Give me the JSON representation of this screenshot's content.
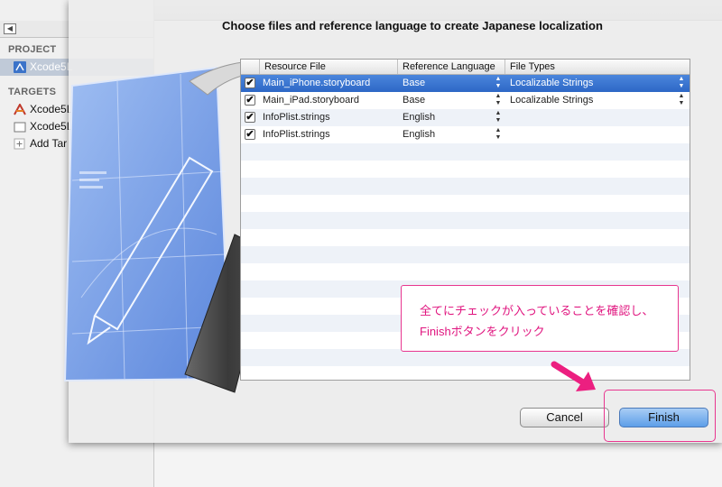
{
  "sheet": {
    "title": "Choose files and reference language to create Japanese localization"
  },
  "navigator": {
    "project_header": "PROJECT",
    "project_item": "Xcode5L",
    "targets_header": "TARGETS",
    "targets": [
      "Xcode5L",
      "Xcode5L",
      "Add Tar"
    ]
  },
  "table": {
    "columns": [
      "Resource File",
      "Reference Language",
      "File Types"
    ],
    "rows": [
      {
        "checked": true,
        "file": "Main_iPhone.storyboard",
        "language": "Base",
        "type": "Localizable Strings",
        "selected": true
      },
      {
        "checked": true,
        "file": "Main_iPad.storyboard",
        "language": "Base",
        "type": "Localizable Strings",
        "selected": false
      },
      {
        "checked": true,
        "file": "InfoPlist.strings",
        "language": "English",
        "type": "",
        "selected": false
      },
      {
        "checked": true,
        "file": "InfoPlist.strings",
        "language": "English",
        "type": "",
        "selected": false
      }
    ]
  },
  "buttons": {
    "cancel": "Cancel",
    "finish": "Finish"
  },
  "annotation": {
    "text": "全てにチェックが入っていることを確認し、\nFinishボタンをクリック",
    "color": "#e0157f"
  },
  "icons": {
    "checkmark": "✔",
    "stepper": "▲▼",
    "back": "◀",
    "forward": "▶"
  }
}
